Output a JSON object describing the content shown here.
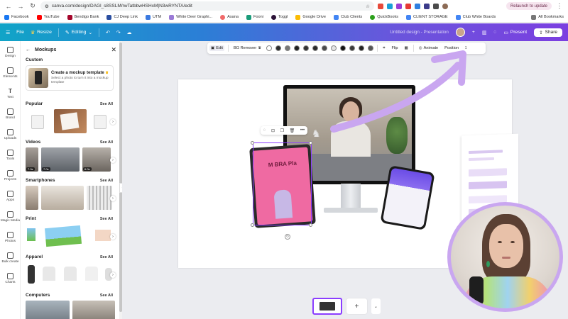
{
  "browser": {
    "url": "canva.com/design/DAGl_s8SSLM/rwTatbbwHSHxM|N3wRYNTA/edit",
    "relaunch_label": "Relaunch to update",
    "bookmarks": [
      {
        "label": "Facebook",
        "color": "#1877f2"
      },
      {
        "label": "YouTube",
        "color": "#ff0000"
      },
      {
        "label": "Bendigo Bank",
        "color": "#a5062c"
      },
      {
        "label": "CJ Deep Link",
        "color": "#2a4ea0"
      },
      {
        "label": "UTM",
        "color": "#3b7ae0"
      },
      {
        "label": "White Deer Graphi...",
        "color": "#9a7ad6"
      },
      {
        "label": "Asana",
        "color": "#f06a6a"
      },
      {
        "label": "Fooni",
        "color": "#1a9c7a"
      },
      {
        "label": "Toggl",
        "color": "#2c1338"
      },
      {
        "label": "Google Drive",
        "color": "#fbbc04"
      },
      {
        "label": "Club Clients",
        "color": "#4285f4"
      },
      {
        "label": "QuickBooks",
        "color": "#2ca01c"
      },
      {
        "label": "CLIENT STORAGE",
        "color": "#4285f4"
      },
      {
        "label": "Club White Boards",
        "color": "#4285f4"
      }
    ],
    "all_bookmarks": "All Bookmarks"
  },
  "topbar": {
    "file": "File",
    "resize": "Resize",
    "editing": "Editing",
    "doc_title": "Untitled design - Presentation",
    "present": "Present",
    "share": "Share"
  },
  "rail": [
    {
      "label": "Design"
    },
    {
      "label": "Elements"
    },
    {
      "label": "Text"
    },
    {
      "label": "Brand"
    },
    {
      "label": "Uploads"
    },
    {
      "label": "Tools"
    },
    {
      "label": "Projects"
    },
    {
      "label": "Apps"
    },
    {
      "label": "Magic Media"
    },
    {
      "label": "Photos"
    },
    {
      "label": "Bulk create"
    },
    {
      "label": "Charts"
    }
  ],
  "panel": {
    "title": "Mockups",
    "custom_label": "Custom",
    "card_title": "Create a mockup template",
    "card_sub": "Select a photo to turn it into a mockup template",
    "see_all": "See All",
    "sections": [
      "Popular",
      "Videos",
      "Smartphones",
      "Print",
      "Apparel",
      "Computers"
    ],
    "video_durations": [
      "7.0s",
      "7.0s",
      "6.0s"
    ]
  },
  "contextbar": {
    "edit": "Edit",
    "bg_remover": "BG Remover",
    "flip": "Flip",
    "animate": "Animate",
    "position": "Position",
    "swatches": [
      "#2b2b2b",
      "#777777",
      "#1f1f1f",
      "#333333",
      "#2a2a2a",
      "#4a4a4a",
      "#e5e5e5",
      "#111111",
      "#3a3a3a",
      "#222222",
      "#555555"
    ]
  },
  "canvas": {
    "tablet_text": "M BRA Pla"
  },
  "colors": {
    "accent": "#8b3dff",
    "arrow": "#c9a6f0"
  }
}
